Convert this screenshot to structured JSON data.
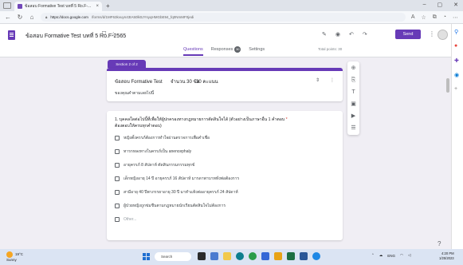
{
  "browser": {
    "tab_title": "ข้อสอบ Formative Test บทที่ 5 Ro.F-...",
    "tab_close": "×",
    "new_tab": "+",
    "url_host": "https://docs.google.com",
    "url_path": "/forms/d/1MF63kvuyn43tA50lk0JYsyqHMGbE94_fq0NmMF0jedi",
    "window_controls": [
      "–",
      "▢",
      "✕"
    ]
  },
  "form_header": {
    "title": "ข้อสอบ Formative Test บทที่ 5 Ro.F-2565",
    "send_label": "Send",
    "tabs": [
      {
        "label": "Questions",
        "active": true
      },
      {
        "label": "Responses",
        "badge": "30"
      },
      {
        "label": "Settings"
      }
    ],
    "total_points": "Total points: 30"
  },
  "section": {
    "tag": "Section 2 of 2",
    "title_left": "ข้อสอบ Formative Test",
    "title_mid": "จำนวน 30 ข้อ",
    "title_right": "30 คะแนน",
    "description": "ของคุณคำตามเลยไปนี้"
  },
  "question": {
    "text": "1. บุคคลใดต่อไปนี้ที่เพื่อให้ผู้ปกครองทางกฎหมายการตัดสินใจได้ (ตัวอย่างเป็นภาษาอื่น 1 คำตอบ",
    "required_mark": "*",
    "text2": "ต้องตอบให้ครบทุกคำตอบ)",
    "options": [
      "หญิงตั้งครรภ์ต้องการทำใจผ่านตรวจการเพื่อคำเชื่อ",
      "ทารกหลงทางในครรภ์เป็น anencephaly",
      "อายุครรภ์ 8 สัปดาห์ ตัดสินกรรมกรรมทุกข์",
      "เด็กหญิงอายุ 14 ปี อายุครรภ์ 16 สัปดาห์ มารดาพาบาททั่งพ่อต้องการ",
      "สามีอายุ 40 ปีพาภรรยาอายุ 30 ปี มาทำแท้งต่ออายุครรภ์ 24 สัปดาห์",
      "ผู้ป่วยหญิงถูกข่มขืนตามกฎหมายนักเรียนตัดสินใจไม่ต้องการ"
    ],
    "other_label": "Other..."
  },
  "taskbar": {
    "temperature": "19°C",
    "weather_text": "Sunny",
    "search_label": "Search",
    "language": "ENG",
    "time": "4:20 PM",
    "date": "1/25/2023"
  },
  "colors": {
    "accent": "#673ab7",
    "required": "#d93025"
  }
}
